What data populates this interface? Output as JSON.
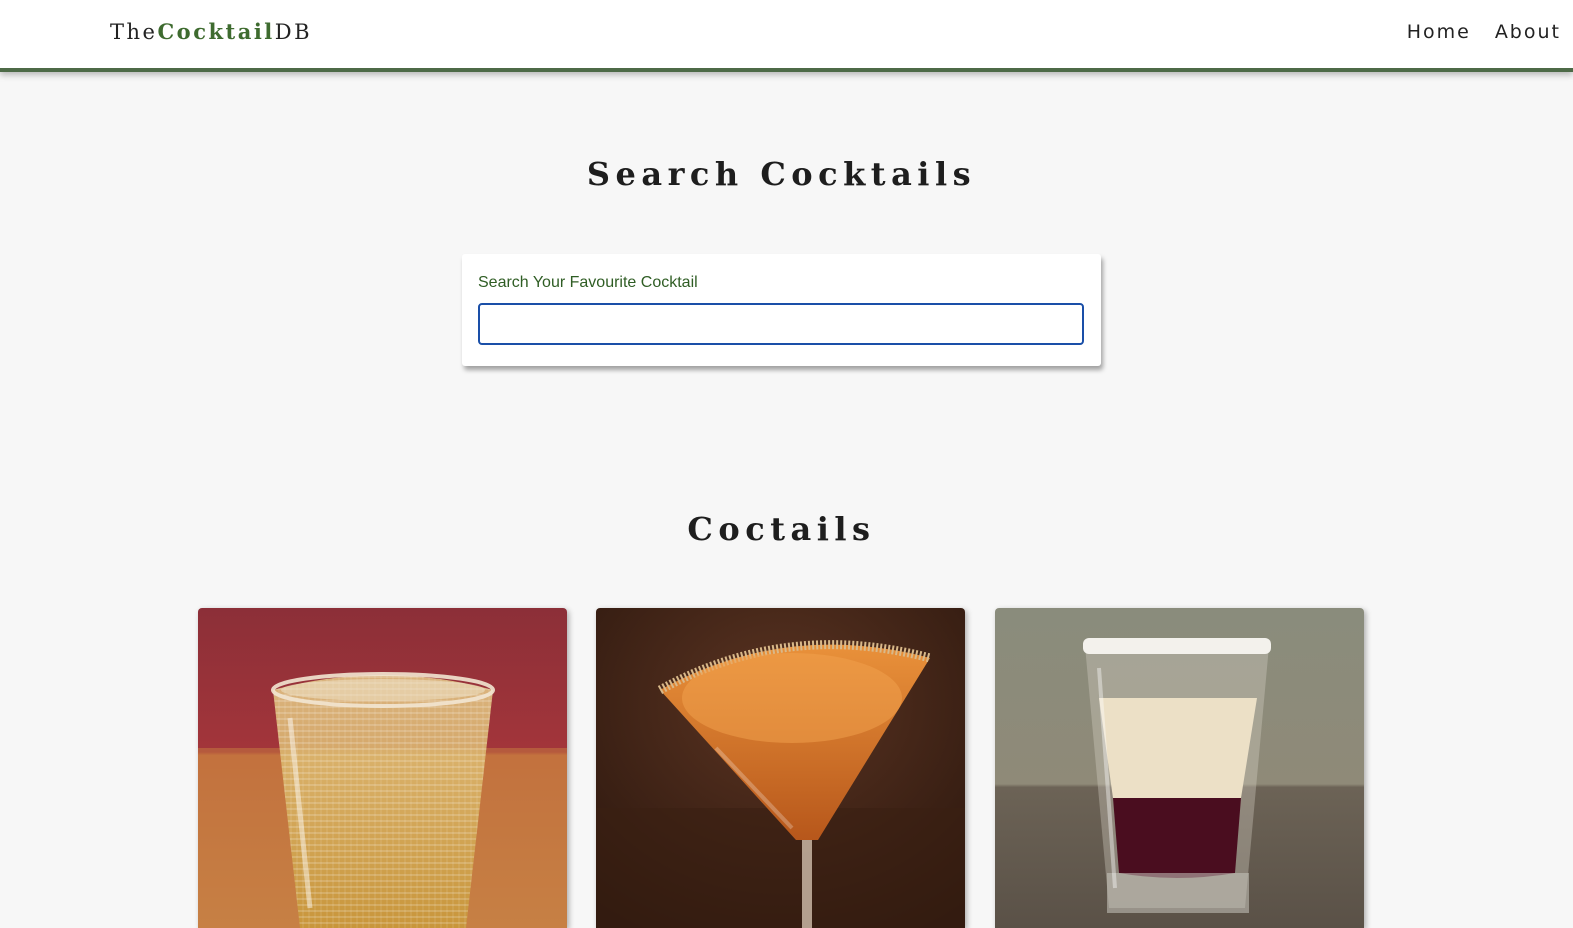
{
  "navbar": {
    "logo": {
      "prefix": "The",
      "accent": "Cocktail",
      "suffix": "DB"
    },
    "links": [
      {
        "label": "Home"
      },
      {
        "label": "About"
      }
    ],
    "accent_color": "#4d6a47"
  },
  "search_section": {
    "title": "Search Cocktails",
    "label": "Search Your Favourite Cocktail",
    "input_value": "",
    "input_border_color": "#1a4fa8"
  },
  "cocktails_section": {
    "title": "Coctails",
    "cards": [
      {
        "image_icon": "whiskey-glass-image"
      },
      {
        "image_icon": "martini-glass-image"
      },
      {
        "image_icon": "shot-glass-image"
      }
    ]
  },
  "colors": {
    "background": "#f7f7f7",
    "logo_accent": "#3e6b2f",
    "label_green": "#2f5d24"
  }
}
